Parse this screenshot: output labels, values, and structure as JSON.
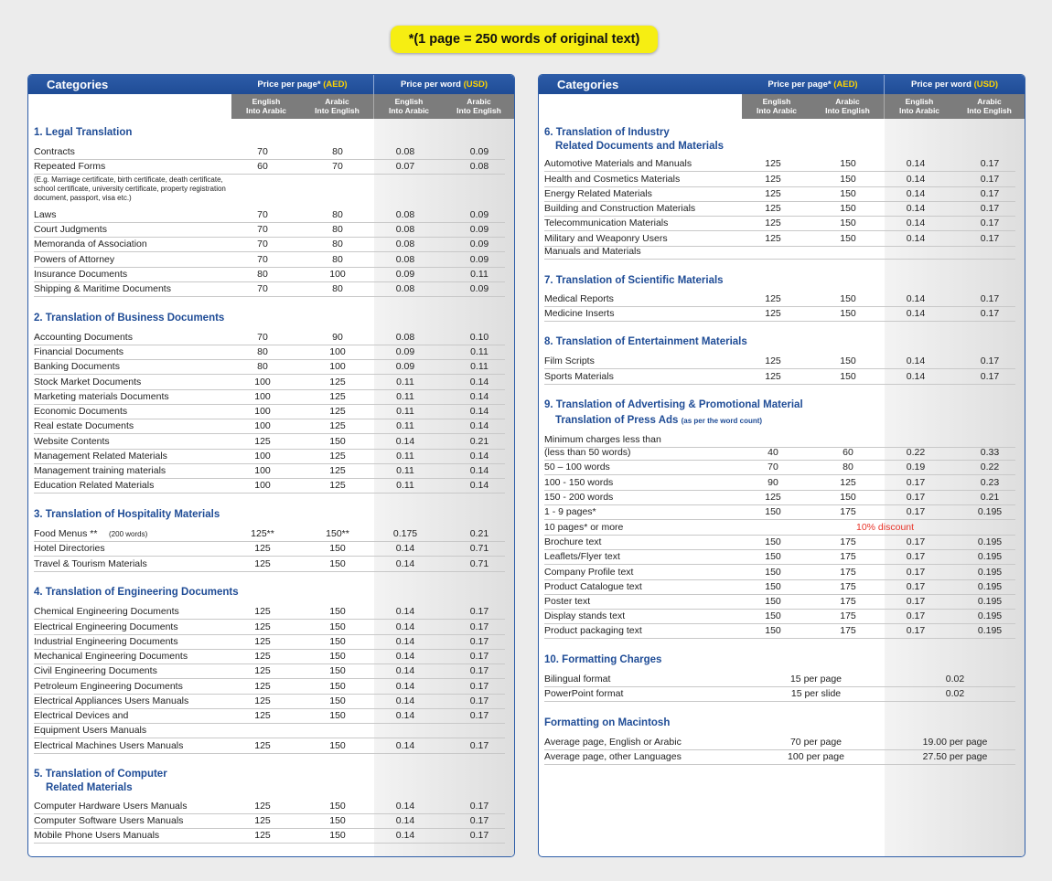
{
  "banner": "*(1 page = 250 words of original text)",
  "header": {
    "categories": "Categories",
    "price_per_page": "Price per page*",
    "price_per_word": "Price per word",
    "aed": "(AED)",
    "usd": "(USD)",
    "sub": [
      "English\nInto Arabic",
      "Arabic\nInto English",
      "English\nInto Arabic",
      "Arabic\nInto English"
    ]
  },
  "left_sections": [
    {
      "title": "1. Legal Translation",
      "rows": [
        [
          "Contracts",
          "70",
          "80",
          "0.08",
          "0.09"
        ],
        [
          "Repeated Forms",
          "60",
          "70",
          "0.07",
          "0.08"
        ],
        [
          "Laws",
          "70",
          "80",
          "0.08",
          "0.09"
        ],
        [
          "Court Judgments",
          "70",
          "80",
          "0.08",
          "0.09"
        ],
        [
          "Memoranda of Association",
          "70",
          "80",
          "0.08",
          "0.09"
        ],
        [
          "Powers of Attorney",
          "70",
          "80",
          "0.08",
          "0.09"
        ],
        [
          "Insurance Documents",
          "80",
          "100",
          "0.09",
          "0.11"
        ],
        [
          "Shipping & Maritime Documents",
          "70",
          "80",
          "0.08",
          "0.09"
        ]
      ],
      "note": "(E.g. Marriage certificate, birth certificate, death certificate, school certificate, university certificate, property registration document, passport, visa etc.)"
    },
    {
      "title": "2. Translation of Business Documents",
      "rows": [
        [
          "Accounting Documents",
          "70",
          "90",
          "0.08",
          "0.10"
        ],
        [
          "Financial Documents",
          "80",
          "100",
          "0.09",
          "0.11"
        ],
        [
          "Banking Documents",
          "80",
          "100",
          "0.09",
          "0.11"
        ],
        [
          "Stock Market Documents",
          "100",
          "125",
          "0.11",
          "0.14"
        ],
        [
          "Marketing materials Documents",
          "100",
          "125",
          "0.11",
          "0.14"
        ],
        [
          "Economic Documents",
          "100",
          "125",
          "0.11",
          "0.14"
        ],
        [
          "Real estate Documents",
          "100",
          "125",
          "0.11",
          "0.14"
        ],
        [
          "Website Contents",
          "125",
          "150",
          "0.14",
          "0.21"
        ],
        [
          "Management Related Materials",
          "100",
          "125",
          "0.11",
          "0.14"
        ],
        [
          "Management training materials",
          "100",
          "125",
          "0.11",
          "0.14"
        ],
        [
          "Education Related Materials",
          "100",
          "125",
          "0.11",
          "0.14"
        ]
      ]
    },
    {
      "title": "3. Translation of Hospitality Materials",
      "rows": [
        [
          "Food Menus **",
          "125**",
          "150**",
          "0.175",
          "0.21"
        ],
        [
          "Hotel Directories",
          "125",
          "150",
          "0.14",
          "0.71"
        ],
        [
          "Travel & Tourism Materials",
          "125",
          "150",
          "0.14",
          "0.71"
        ]
      ],
      "food_note": "(200 words)"
    },
    {
      "title": "4. Translation of Engineering Documents",
      "rows": [
        [
          "Chemical Engineering Documents",
          "125",
          "150",
          "0.14",
          "0.17"
        ],
        [
          "Electrical Engineering Documents",
          "125",
          "150",
          "0.14",
          "0.17"
        ],
        [
          "Industrial Engineering Documents",
          "125",
          "150",
          "0.14",
          "0.17"
        ],
        [
          "Mechanical Engineering Documents",
          "125",
          "150",
          "0.14",
          "0.17"
        ],
        [
          "Civil Engineering Documents",
          "125",
          "150",
          "0.14",
          "0.17"
        ],
        [
          "Petroleum Engineering Documents",
          "125",
          "150",
          "0.14",
          "0.17"
        ],
        [
          "Electrical Appliances Users Manuals",
          "125",
          "150",
          "0.14",
          "0.17"
        ],
        [
          "Electrical Devices and",
          "125",
          "150",
          "0.14",
          "0.17"
        ],
        [
          "Equipment Users Manuals",
          "",
          "",
          "",
          ""
        ],
        [
          "Electrical Machines Users Manuals",
          "125",
          "150",
          "0.14",
          "0.17"
        ]
      ]
    },
    {
      "title": "5. Translation of Computer",
      "title2": "Related Materials",
      "rows": [
        [
          "Computer Hardware Users Manuals",
          "125",
          "150",
          "0.14",
          "0.17"
        ],
        [
          "Computer Software Users Manuals",
          "125",
          "150",
          "0.14",
          "0.17"
        ],
        [
          "Mobile Phone Users Manuals",
          "125",
          "150",
          "0.14",
          "0.17"
        ]
      ]
    }
  ],
  "right_sections": [
    {
      "title": "6. Translation of Industry",
      "title2": "Related Documents and Materials",
      "rows": [
        [
          "Automotive Materials and Manuals",
          "125",
          "150",
          "0.14",
          "0.17"
        ],
        [
          "Health and Cosmetics Materials",
          "125",
          "150",
          "0.14",
          "0.17"
        ],
        [
          "Energy Related Materials",
          "125",
          "150",
          "0.14",
          "0.17"
        ],
        [
          "Building and Construction Materials",
          "125",
          "150",
          "0.14",
          "0.17"
        ],
        [
          "Telecommunication Materials",
          "125",
          "150",
          "0.14",
          "0.17"
        ],
        [
          "Military and Weaponry Users",
          "125",
          "150",
          "0.14",
          "0.17"
        ],
        [
          "Manuals and Materials",
          "",
          "",
          "",
          ""
        ]
      ]
    },
    {
      "title": "7.  Translation of Scientific Materials",
      "rows": [
        [
          "Medical Reports",
          "125",
          "150",
          "0.14",
          "0.17"
        ],
        [
          "Medicine Inserts",
          "125",
          "150",
          "0.14",
          "0.17"
        ]
      ]
    },
    {
      "title": "8. Translation of Entertainment Materials",
      "rows": [
        [
          "Film Scripts",
          "125",
          "150",
          "0.14",
          "0.17"
        ],
        [
          "Sports Materials",
          "125",
          "150",
          "0.14",
          "0.17"
        ]
      ]
    },
    {
      "title": "9. Translation of Advertising & Promotional Material",
      "title2": "Translation of Press Ads",
      "title2_note": "(as per the word count)",
      "rows": [
        [
          "Minimum charges less than",
          "",
          "",
          "",
          ""
        ],
        [
          "(less than 50 words)",
          "40",
          "60",
          "0.22",
          "0.33"
        ],
        [
          "50 – 100 words",
          "70",
          "80",
          "0.19",
          "0.22"
        ],
        [
          "100 - 150 words",
          "90",
          "125",
          "0.17",
          "0.23"
        ],
        [
          "150 - 200 words",
          "125",
          "150",
          "0.17",
          "0.21"
        ],
        [
          "1 - 9 pages*",
          "150",
          "175",
          "0.17",
          "0.195"
        ],
        [
          "10 pages* or more",
          "",
          "",
          "",
          ""
        ],
        [
          "Brochure text",
          "150",
          "175",
          "0.17",
          "0.195"
        ],
        [
          "Leaflets/Flyer text",
          "150",
          "175",
          "0.17",
          "0.195"
        ],
        [
          "Company Profile text",
          "150",
          "175",
          "0.17",
          "0.195"
        ],
        [
          "Product Catalogue text",
          "150",
          "175",
          "0.17",
          "0.195"
        ],
        [
          "Poster text",
          "150",
          "175",
          "0.17",
          "0.195"
        ],
        [
          "Display stands text",
          "150",
          "175",
          "0.17",
          "0.195"
        ],
        [
          "Product packaging text",
          "150",
          "175",
          "0.17",
          "0.195"
        ]
      ],
      "discount": "10% discount"
    },
    {
      "title": "10. Formatting Charges",
      "rows": [
        [
          "Bilingual format",
          "15 per page",
          "0.02"
        ],
        [
          "PowerPoint format",
          "15 per slide",
          "0.02"
        ]
      ]
    },
    {
      "title": "Formatting on Macintosh",
      "rows": [
        [
          "Average page, English or Arabic",
          "70 per page",
          "19.00 per page"
        ],
        [
          "Average page, other Languages",
          "100 per page",
          "27.50 per page"
        ]
      ]
    }
  ],
  "colors": {
    "header_blue": "#1f4c96",
    "banner_yellow": "#f6ee12",
    "sub_header_gray": "#7c7c7c",
    "discount_red": "#e8352a",
    "currency_yellow": "#ffd400"
  }
}
